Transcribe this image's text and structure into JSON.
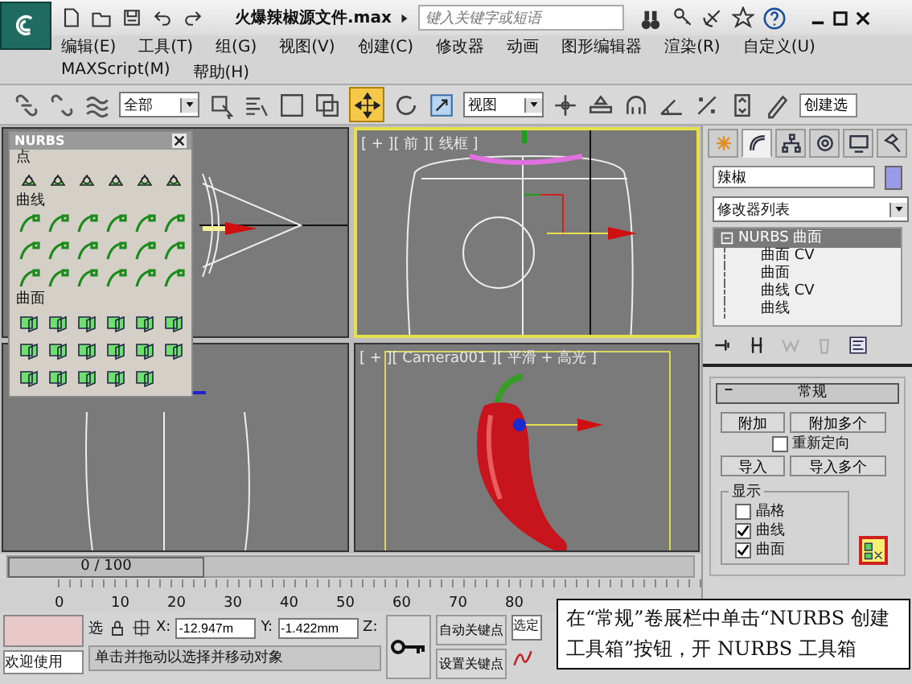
{
  "title_bar": {
    "file_title": "火爆辣椒源文件.max",
    "search": {
      "placeholder": "键入关键字或短语"
    }
  },
  "menu": [
    "编辑(E)",
    "工具(T)",
    "组(G)",
    "视图(V)",
    "创建(C)",
    "修改器",
    "动画",
    "图形编辑器",
    "渲染(R)",
    "自定义(U)",
    "MAXScript(M)",
    "帮助(H)"
  ],
  "toolbar": {
    "selection_filter": "全部",
    "reference_coord": "视图",
    "named_selection": "创建选",
    "move_active": true
  },
  "viewports": [
    {
      "kind": "wire-side",
      "active": false
    },
    {
      "kind": "wire-front",
      "label": "[ + ][ 前 ][ 线框 ]",
      "active": true
    },
    {
      "kind": "wire-base",
      "active": false
    },
    {
      "kind": "shaded",
      "label": "[ + ][ Camera001 ][ 平滑 + 高光 ]",
      "active": false
    }
  ],
  "nurbs_toolbox": {
    "title": "NURBS",
    "sections": [
      "点",
      "曲线",
      "曲面"
    ]
  },
  "command_panel": {
    "tabs": [
      {
        "selected": false
      },
      {
        "selected": true
      },
      {
        "selected": false
      },
      {
        "selected": false
      },
      {
        "selected": false
      },
      {
        "selected": false
      }
    ],
    "object_name": "辣椒",
    "modifier_list": "修改器列表",
    "stack": [
      {
        "label": "NURBS 曲面",
        "selected": true,
        "children": [
          {
            "label": "曲面 CV",
            "selected": false
          },
          {
            "label": "曲面",
            "selected": false
          },
          {
            "label": "曲线 CV",
            "selected": false
          },
          {
            "label": "曲线",
            "selected": false
          }
        ]
      }
    ],
    "rollout": {
      "title": "常规",
      "expanded": true,
      "buttons": [
        "附加",
        "附加多个"
      ],
      "reorient": {
        "label": "重新定向",
        "checked": false
      },
      "import_buttons": [
        "导入",
        "导入多个"
      ],
      "display": {
        "title": "显示",
        "items": [
          {
            "label": "晶格",
            "checked": false
          },
          {
            "label": "曲线",
            "checked": true
          },
          {
            "label": "曲面",
            "checked": true
          }
        ]
      }
    }
  },
  "time_slider": {
    "position": "0 / 100",
    "level": 0,
    "ticks": [
      "0",
      "10",
      "20",
      "30",
      "40",
      "50",
      "60",
      "70",
      "80"
    ]
  },
  "status_bar": {
    "welcome": "欢迎使用",
    "selection": "选",
    "x_label": "X:",
    "x": "-12.947m",
    "y_label": "Y:",
    "y": "-1.422mm",
    "z_label": "Z:",
    "auto_key": "自动关键点",
    "set_key": "设置关键点",
    "key_filter": "选定",
    "prompt": "单击并拖动以选择并移动对象"
  },
  "callout": "在“常规”卷展栏中单击“NURBS 创建工具箱”按钮，开 NURBS 工具箱"
}
